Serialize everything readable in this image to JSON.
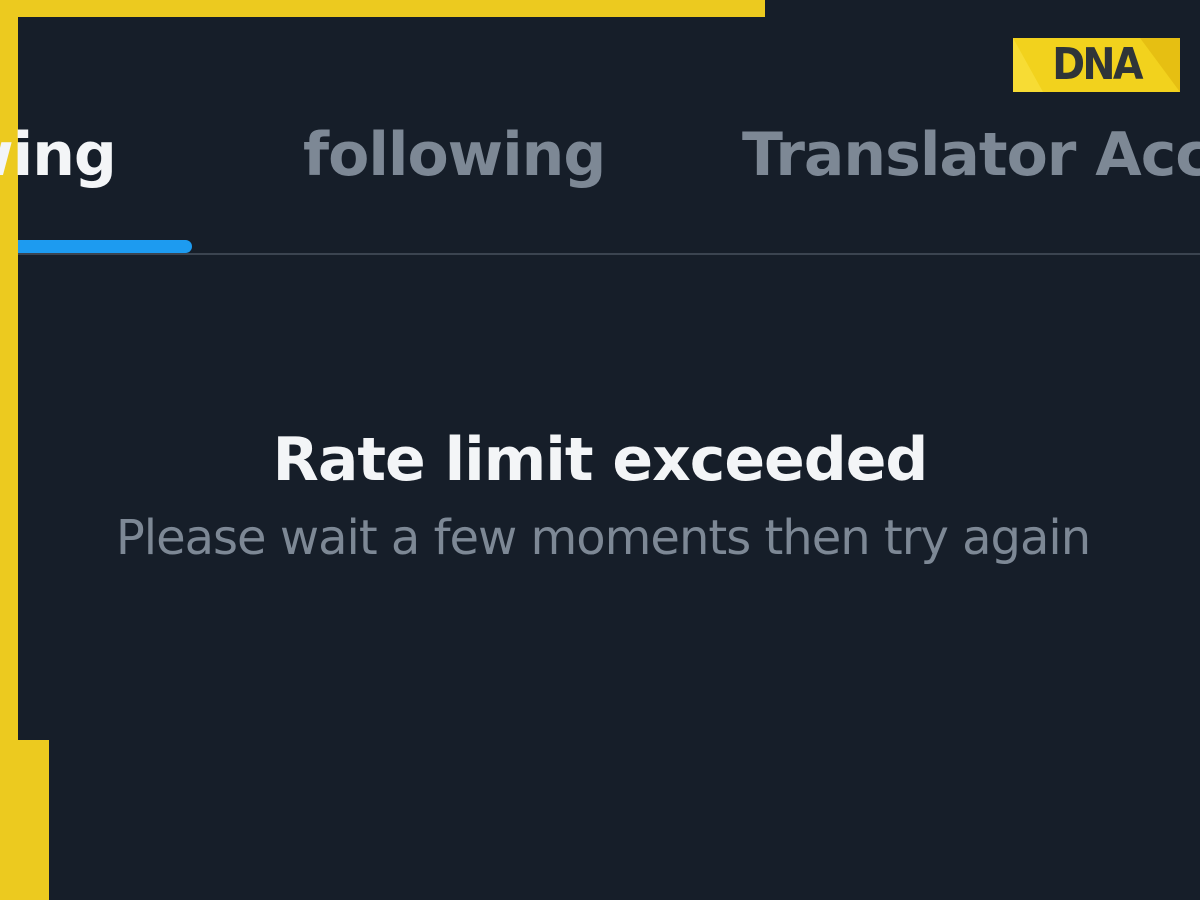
{
  "tabs": [
    {
      "label": "owing",
      "active": true
    },
    {
      "label": "following",
      "active": false
    },
    {
      "label": "Translator Acc",
      "active": false
    }
  ],
  "message": {
    "title": "Rate limit exceeded",
    "subtitle": "Please wait a few moments then try again"
  },
  "logo": {
    "text": "DNA"
  },
  "colors": {
    "background": "#161e29",
    "frame": "#ecca1f",
    "accent": "#1d9bf0",
    "primary_text": "#f3f5f7",
    "secondary_text": "#7d8895"
  }
}
